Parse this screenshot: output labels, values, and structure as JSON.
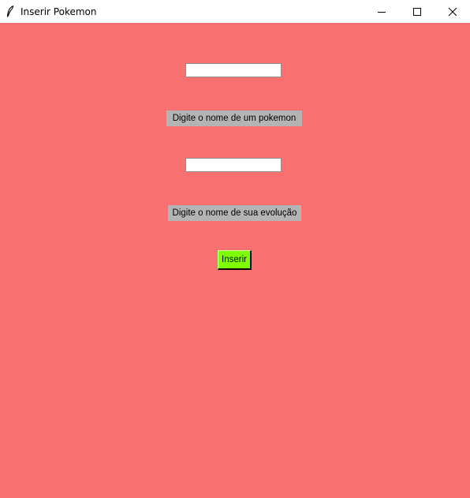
{
  "window": {
    "title": "Inserir Pokemon",
    "background_color": "#fa7070",
    "icon": "feather-icon",
    "controls": {
      "minimize_icon": "minimize-icon",
      "maximize_icon": "maximize-icon",
      "close_icon": "close-icon"
    }
  },
  "form": {
    "pokemon_name": {
      "value": "",
      "label": "Digite o nome de um pokemon"
    },
    "evolution_name": {
      "value": "",
      "label": "Digite o nome de sua evolução"
    },
    "submit_label": "Inserir",
    "submit_color": "#80ff00",
    "label_color": "#b4b4b4"
  }
}
